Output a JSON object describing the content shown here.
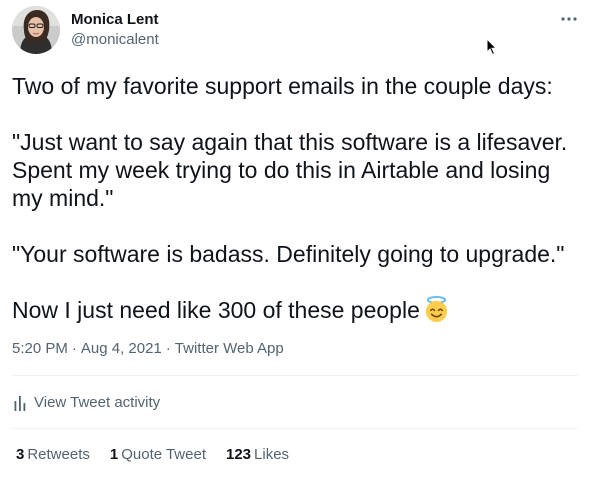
{
  "author": {
    "name": "Monica Lent",
    "handle": "@monicalent"
  },
  "tweet": {
    "lines": [
      "Two of my favorite support emails in the couple days:",
      "\"Just want to say again that this software is a lifesaver.",
      "Spent my week trying to do this in Airtable and losing",
      "my mind.\"",
      "\"Your software is badass. Definitely going to upgrade.\"",
      "Now I just need like 300 of these people"
    ],
    "emoji": "smiling-face-with-halo"
  },
  "meta": {
    "time": "5:20 PM",
    "separator": "·",
    "date": "Aug 4, 2021",
    "source": "Twitter Web App"
  },
  "activity": {
    "label": "View Tweet activity",
    "icon": "bar-chart-icon"
  },
  "stats": {
    "retweets_count": "3",
    "retweets_label": "Retweets",
    "quotes_count": "1",
    "quotes_label": "Quote Tweet",
    "likes_count": "123",
    "likes_label": "Likes"
  },
  "colors": {
    "text": "#0f1419",
    "secondary": "#536471",
    "divider": "#eff3f4"
  }
}
